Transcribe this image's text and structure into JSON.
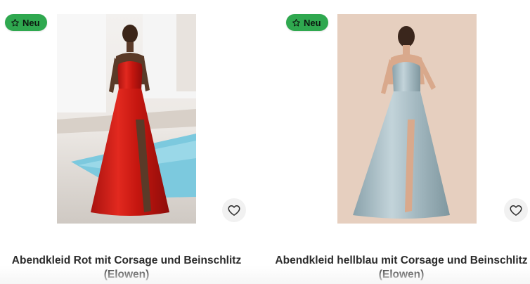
{
  "products": [
    {
      "badge": "Neu",
      "title": "Abendkleid Rot mit Corsage und Beinschlitz (Elowen)",
      "image_alt": "red satin evening dress",
      "dress_color": "#d9211c"
    },
    {
      "badge": "Neu",
      "title": "Abendkleid hellblau mit Corsage und Beinschlitz (Elowen)",
      "image_alt": "light blue satin evening dress",
      "dress_color": "#a9bfc7"
    }
  ],
  "colors": {
    "badge_bg": "#2fa84f",
    "title_text": "#2b2b2b",
    "wishlist_bg": "#f1f1f1"
  },
  "icons": {
    "badge": "star-icon",
    "wishlist": "heart-icon"
  }
}
